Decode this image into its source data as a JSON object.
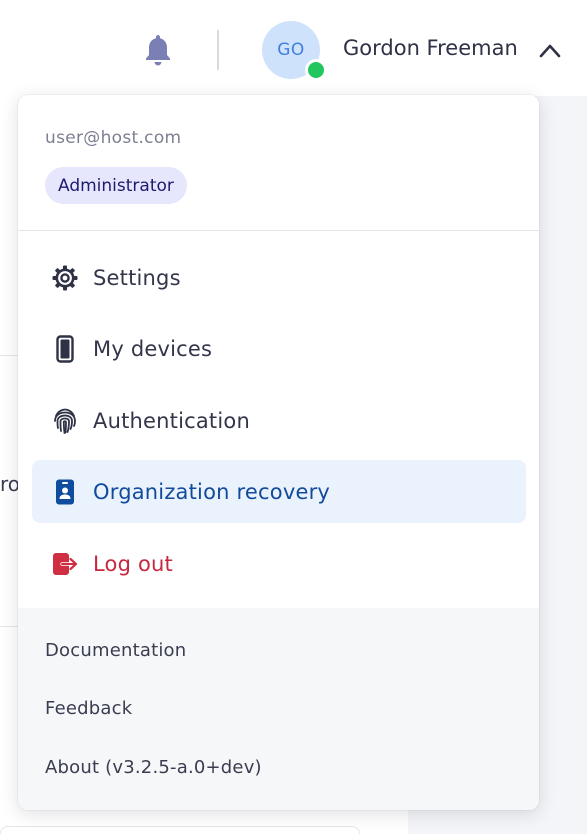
{
  "colors": {
    "accent": "#124a9c",
    "active_bg": "#eaf3fd",
    "badge_bg": "#e6e7fc",
    "danger": "#c8283f",
    "presence": "#22c55e",
    "avatar_bg": "#cfe2fb"
  },
  "background": {
    "fragment_text": "rof"
  },
  "header": {
    "notifications_icon": "bell-icon",
    "avatar_initials": "GO",
    "user_name": "Gordon Freeman",
    "menu_toggle_icon": "chevron-up-icon"
  },
  "dropdown": {
    "email": "user@host.com",
    "role": "Administrator",
    "items": [
      {
        "label": "Settings",
        "icon": "gear-icon"
      },
      {
        "label": "My devices",
        "icon": "smartphone-icon"
      },
      {
        "label": "Authentication",
        "icon": "fingerprint-icon"
      },
      {
        "label": "Organization recovery",
        "icon": "id-badge-icon",
        "active": true
      },
      {
        "label": "Log out",
        "icon": "logout-icon"
      }
    ],
    "footer_links": [
      {
        "label": "Documentation"
      },
      {
        "label": "Feedback"
      },
      {
        "label": "About (v3.2.5-a.0+dev)"
      }
    ]
  }
}
